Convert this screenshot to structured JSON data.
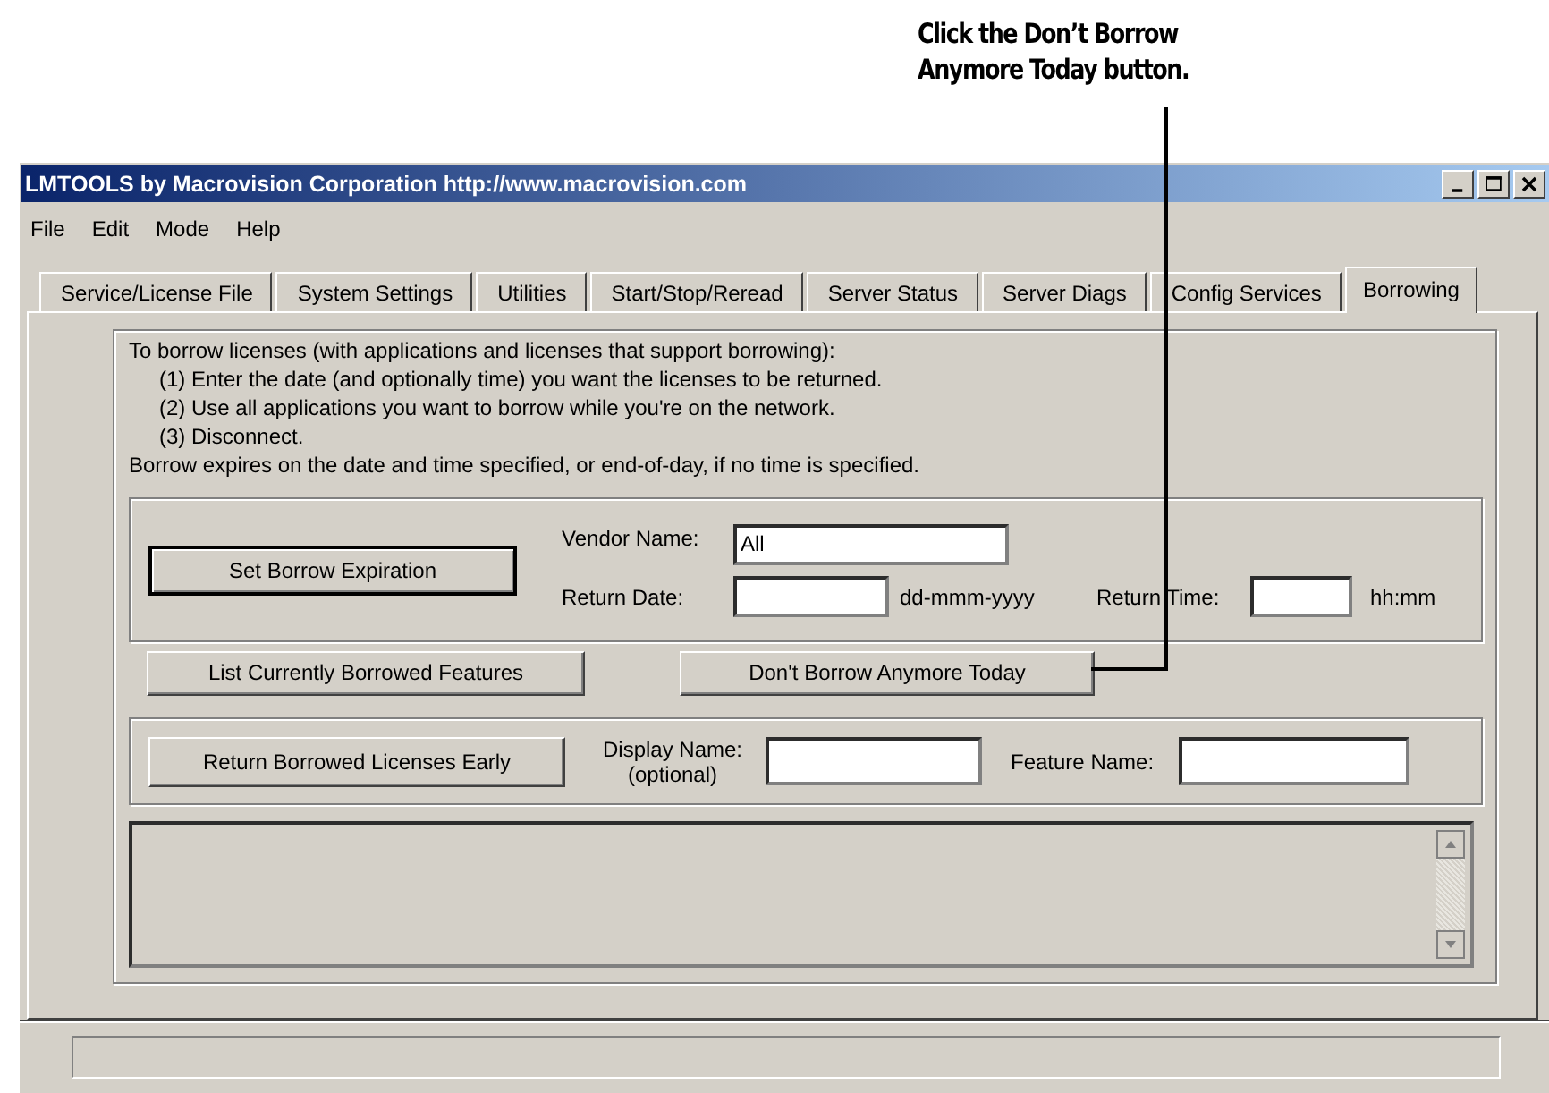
{
  "callout": {
    "text": "Click the Don’t Borrow Anymore Today button."
  },
  "window": {
    "title": "LMTOOLS by Macrovision Corporation http://www.macrovision.com"
  },
  "menu": [
    "File",
    "Edit",
    "Mode",
    "Help"
  ],
  "tabs": [
    {
      "label": "Service/License File",
      "selected": false
    },
    {
      "label": "System Settings",
      "selected": false
    },
    {
      "label": "Utilities",
      "selected": false
    },
    {
      "label": "Start/Stop/Reread",
      "selected": false
    },
    {
      "label": "Server Status",
      "selected": false
    },
    {
      "label": "Server Diags",
      "selected": false
    },
    {
      "label": "Config Services",
      "selected": false
    },
    {
      "label": "Borrowing",
      "selected": true
    }
  ],
  "instructions": {
    "intro": "To borrow licenses (with applications and licenses that support borrowing):",
    "steps": [
      "(1) Enter the date (and optionally time) you want the licenses to be returned.",
      "(2) Use all applications you want to borrow while you're on the network.",
      "(3) Disconnect."
    ],
    "note": "Borrow expires on the date and time specified, or end-of-day, if no time is specified."
  },
  "expiration_group": {
    "button": "Set Borrow Expiration",
    "vendor_label": "Vendor Name:",
    "vendor_value": "All",
    "date_label": "Return Date:",
    "date_format": "dd-mmm-yyyy",
    "time_label": "Return Time:",
    "time_format": "hh:mm"
  },
  "actions": [
    "List Currently Borrowed Features",
    "Don't Borrow Anymore Today"
  ],
  "return_group": {
    "button": "Return Borrowed Licenses Early",
    "display_label": "Display Name: (optional)",
    "feature_label": "Feature Name:"
  }
}
